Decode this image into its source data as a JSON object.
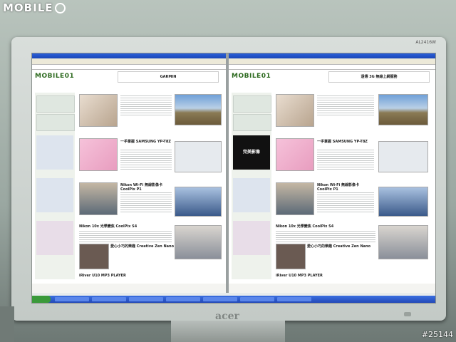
{
  "photo": {
    "watermark_logo": "MOBILE",
    "post_number": "#25144"
  },
  "monitor": {
    "brand": "acer",
    "model": "AL2416W"
  },
  "website": {
    "logo": "MOBILE01",
    "left_window": {
      "ad_text": "GARMIN",
      "articles": [
        {
          "title": "Nikon Wi-Fi 無線影像卡 CoolPix P1"
        },
        {
          "title": "Nikon 10x 光學變焦 CoolPix S4"
        },
        {
          "title": "一手掌握 SAMSUNG YP-T8Z"
        },
        {
          "title": "愛心小巧的樂趣 Creative Zen Nano"
        },
        {
          "title": "全新好聲 ZEN MICRO"
        },
        {
          "title": "iRiver U10 MP3 PLAYER"
        }
      ]
    },
    "right_window": {
      "ad_text": "遠傳 3G 無線上網服務",
      "side_ad": "完美影像",
      "articles": [
        {
          "title": "Nikon Wi-Fi 無線影像卡 CoolPix P1"
        },
        {
          "title": "Nikon 10x 光學變焦 CoolPix S4"
        },
        {
          "title": "一手掌握 SAMSUNG YP-T8Z"
        },
        {
          "title": "愛心小巧的樂趣 Creative Zen Nano"
        },
        {
          "title": "iRiver U10 MP3 PLAYER"
        }
      ]
    }
  }
}
